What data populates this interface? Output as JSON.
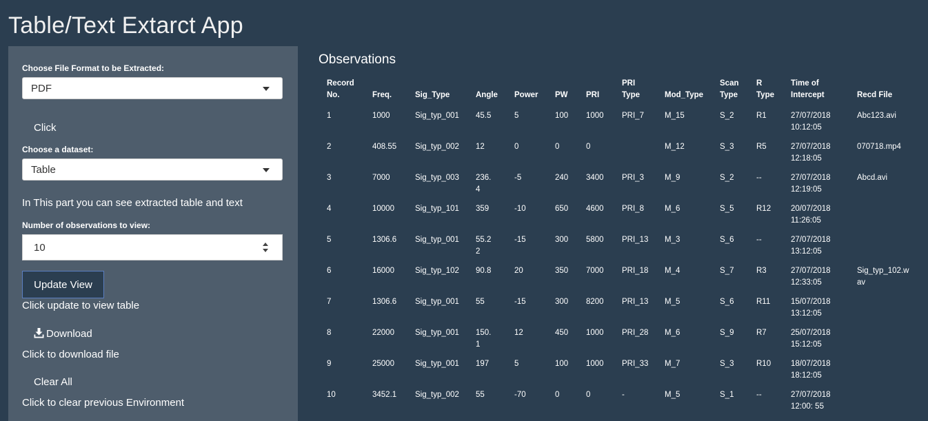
{
  "app": {
    "title": "Table/Text Extarct App"
  },
  "sidebar": {
    "format_label": "Choose File Format to be Extracted:",
    "format_value": "PDF",
    "click_label": "Click",
    "dataset_label": "Choose a dataset:",
    "dataset_value": "Table",
    "info_text": "In This part you can see extracted table and text",
    "obs_label": "Number of observations to view:",
    "obs_value": "10",
    "update_label": "Update View",
    "update_help": "Click update to view table",
    "download_label": "Download",
    "download_help": "Click to download file",
    "clear_label": "Clear All",
    "clear_help": "Click to clear previous Environment"
  },
  "main": {
    "title": "Observations",
    "columns": [
      [
        "Record",
        "No."
      ],
      [
        "Freq."
      ],
      [
        "Sig_Type"
      ],
      [
        "Angle"
      ],
      [
        "Power"
      ],
      [
        "PW"
      ],
      [
        "PRI"
      ],
      [
        "PRI",
        "Type"
      ],
      [
        "Mod_Type"
      ],
      [
        "Scan",
        "Type"
      ],
      [
        "R",
        "Type"
      ],
      [
        "Time of",
        "Intercept"
      ],
      [
        "Recd File"
      ]
    ],
    "rows": [
      [
        [
          "1"
        ],
        [
          "1000"
        ],
        [
          "Sig_typ_001"
        ],
        [
          "45.5"
        ],
        [
          "5"
        ],
        [
          "100"
        ],
        [
          "1000"
        ],
        [
          "PRI_7"
        ],
        [
          "M_15"
        ],
        [
          "S_2"
        ],
        [
          "R1"
        ],
        [
          "27/07/2018",
          "10:12:05"
        ],
        [
          "Abc123.avi"
        ]
      ],
      [
        [
          "2"
        ],
        [
          "408.55"
        ],
        [
          "Sig_typ_002"
        ],
        [
          "12"
        ],
        [
          "0"
        ],
        [
          "0"
        ],
        [
          "0"
        ],
        [
          ""
        ],
        [
          "M_12"
        ],
        [
          "S_3"
        ],
        [
          "R5"
        ],
        [
          "27/07/2018",
          "12:18:05"
        ],
        [
          "070718.mp4"
        ]
      ],
      [
        [
          "3"
        ],
        [
          "7000"
        ],
        [
          "Sig_typ_003"
        ],
        [
          "236.",
          "4"
        ],
        [
          "-5"
        ],
        [
          "240"
        ],
        [
          "3400"
        ],
        [
          "PRI_3"
        ],
        [
          "M_9"
        ],
        [
          "S_2"
        ],
        [
          "--"
        ],
        [
          "27/07/2018",
          "12:19:05"
        ],
        [
          "Abcd.avi"
        ]
      ],
      [
        [
          "4"
        ],
        [
          "10000"
        ],
        [
          "Sig_typ_101"
        ],
        [
          "359"
        ],
        [
          "-10"
        ],
        [
          "650"
        ],
        [
          "4600"
        ],
        [
          "PRI_8"
        ],
        [
          "M_6"
        ],
        [
          "S_5"
        ],
        [
          "R12"
        ],
        [
          "20/07/2018",
          "11:26:05"
        ],
        [
          ""
        ]
      ],
      [
        [
          "5"
        ],
        [
          "1306.6"
        ],
        [
          "Sig_typ_001"
        ],
        [
          "55.2",
          "2"
        ],
        [
          "-15"
        ],
        [
          "300"
        ],
        [
          "5800"
        ],
        [
          "PRI_13"
        ],
        [
          "M_3"
        ],
        [
          "S_6"
        ],
        [
          "--"
        ],
        [
          "27/07/2018",
          "13:12:05"
        ],
        [
          ""
        ]
      ],
      [
        [
          "6"
        ],
        [
          "16000"
        ],
        [
          "Sig_typ_102"
        ],
        [
          "90.8"
        ],
        [
          "20"
        ],
        [
          "350"
        ],
        [
          "7000"
        ],
        [
          "PRI_18"
        ],
        [
          "M_4"
        ],
        [
          "S_7"
        ],
        [
          "R3"
        ],
        [
          "27/07/2018",
          "12:33:05"
        ],
        [
          "Sig_typ_102.w",
          "av"
        ]
      ],
      [
        [
          "7"
        ],
        [
          "1306.6"
        ],
        [
          "Sig_typ_001"
        ],
        [
          "55"
        ],
        [
          "-15"
        ],
        [
          "300"
        ],
        [
          "8200"
        ],
        [
          "PRI_13"
        ],
        [
          "M_5"
        ],
        [
          "S_6"
        ],
        [
          "R11"
        ],
        [
          "15/07/2018",
          "13:12:05"
        ],
        [
          ""
        ]
      ],
      [
        [
          "8"
        ],
        [
          "22000"
        ],
        [
          "Sig_typ_001"
        ],
        [
          "150.",
          "1"
        ],
        [
          "12"
        ],
        [
          "450"
        ],
        [
          "1000"
        ],
        [
          "PRI_28"
        ],
        [
          "M_6"
        ],
        [
          "S_9"
        ],
        [
          "R7"
        ],
        [
          "25/07/2018",
          "15:12:05"
        ],
        [
          ""
        ]
      ],
      [
        [
          "9"
        ],
        [
          "25000"
        ],
        [
          "Sig_typ_001"
        ],
        [
          "197"
        ],
        [
          "5"
        ],
        [
          "100"
        ],
        [
          "1000"
        ],
        [
          "PRI_33"
        ],
        [
          "M_7"
        ],
        [
          "S_3"
        ],
        [
          "R10"
        ],
        [
          "18/07/2018",
          "18:12:05"
        ],
        [
          ""
        ]
      ],
      [
        [
          "10"
        ],
        [
          "3452.1"
        ],
        [
          "Sig_typ_002"
        ],
        [
          "55"
        ],
        [
          "-70"
        ],
        [
          "0"
        ],
        [
          "0"
        ],
        [
          "-"
        ],
        [
          "M_5"
        ],
        [
          "S_1"
        ],
        [
          "--"
        ],
        [
          "27/07/2018",
          "12:00: 55"
        ],
        [
          ""
        ]
      ]
    ]
  }
}
